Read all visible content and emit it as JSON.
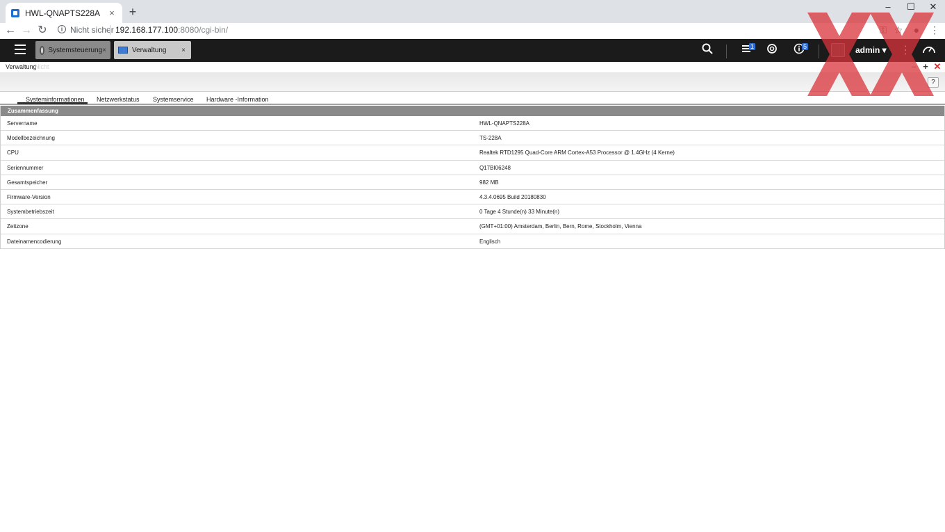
{
  "browser": {
    "tab_title": "HWL-QNAPTS228A",
    "tab_close": "×",
    "new_tab": "+",
    "minimize": "–",
    "maximize": "☐",
    "close": "✕",
    "security_label": "Nicht sicher",
    "url_host": "192.168.177.100",
    "url_rest": ":8080/cgi-bin/"
  },
  "qnap": {
    "tabs": [
      {
        "label": "Systemsteuerung",
        "close": "×"
      },
      {
        "label": "Verwaltung",
        "close": "×"
      }
    ],
    "badges": {
      "tasks": "1",
      "info": "5"
    },
    "user": "admin ▾"
  },
  "window": {
    "title": "Verwaltung",
    "subtitle": "Nicht",
    "minimize": "–",
    "maximize": "+",
    "close": "✕",
    "help": "?"
  },
  "section_tabs": [
    "Systeminformationen",
    "Netzwerkstatus",
    "Systemservice",
    "Hardware -Information"
  ],
  "summary": {
    "header": "Zusammenfassung",
    "rows": [
      {
        "key": "Servername",
        "value": "HWL-QNAPTS228A"
      },
      {
        "key": "Modellbezeichnung",
        "value": "TS-228A"
      },
      {
        "key": "CPU",
        "value": "Realtek RTD1295 Quad-Core ARM Cortex-A53 Processor @ 1.4GHz (4 Kerne)"
      },
      {
        "key": "Seriennummer",
        "value": "Q17BI06248"
      },
      {
        "key": "Gesamtspeicher",
        "value": "982 MB"
      },
      {
        "key": "Firmware-Version",
        "value": "4.3.4.0695 Build 20180830"
      },
      {
        "key": "Systembetriebszeit",
        "value": "0 Tage 4 Stunde(n) 33 Minute(n)"
      },
      {
        "key": "Zeitzone",
        "value": "(GMT+01:00) Amsterdam, Berlin, Bern, Rome, Stockholm, Vienna"
      },
      {
        "key": "Dateinamencodierung",
        "value": "Englisch"
      }
    ]
  }
}
